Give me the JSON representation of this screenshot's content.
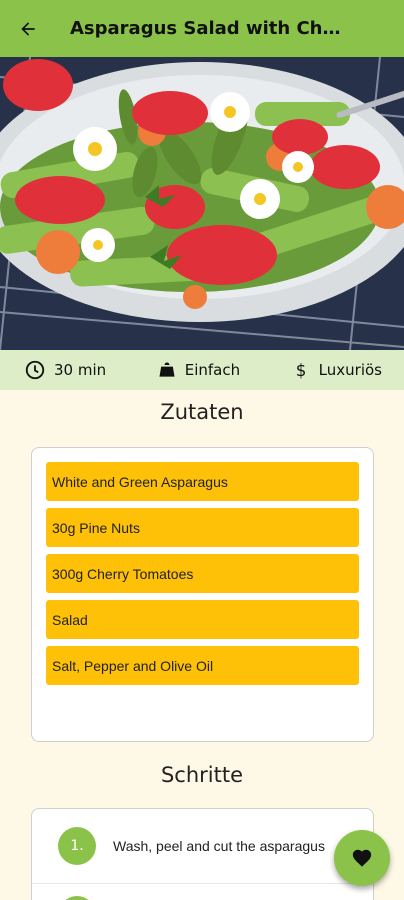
{
  "app_bar": {
    "title": "Asparagus Salad with Cherry Tomatoes",
    "back_icon": "arrow-back-icon"
  },
  "hero_image": {
    "subject": "salad-photo"
  },
  "meta": {
    "duration": "30 min",
    "complexity": "Einfach",
    "affordability": "Luxuriös",
    "icons": [
      "clock-icon",
      "weight-icon",
      "dollar-icon"
    ]
  },
  "ingredients": {
    "heading": "Zutaten",
    "items": [
      "White and Green Asparagus",
      "30g Pine Nuts",
      "300g Cherry Tomatoes",
      "Salad",
      "Salt, Pepper and Olive Oil"
    ]
  },
  "steps": {
    "heading": "Schritte",
    "items": [
      {
        "number": "1.",
        "text": "Wash, peel and cut the asparagus"
      }
    ]
  },
  "fab": {
    "icon": "heart-icon"
  },
  "colors": {
    "primary": "#8BC34A",
    "primary_light": "#DCEDC8",
    "accent": "#FFC107",
    "background": "#FEF9E6"
  }
}
